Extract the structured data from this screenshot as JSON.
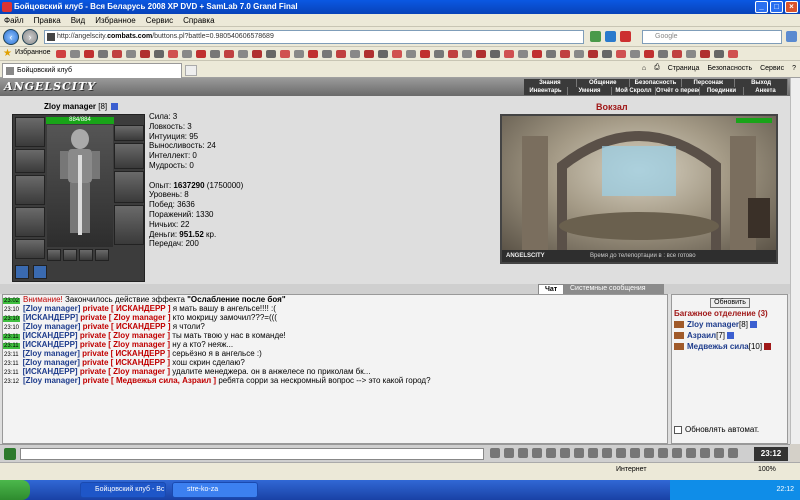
{
  "window": {
    "title": "Бойцовский клуб - Вся Беларусь 2008 XP DVD + SamLab 7.0 Grand Final"
  },
  "menu": [
    "Файл",
    "Правка",
    "Вид",
    "Избранное",
    "Сервис",
    "Справка"
  ],
  "address": {
    "url_prefix": "http://angelscity.",
    "url_domain": "combats.com",
    "url_suffix": "/buttons.pl?battle=0.980540606578689",
    "search_placeholder": "Google"
  },
  "favorites": {
    "label": "Избранное"
  },
  "tab": {
    "title": "Бойцовский клуб"
  },
  "command_bar": {
    "page": "Страница",
    "security": "Безопасность",
    "service": "Сервис"
  },
  "game": {
    "logo": "ANGELSCITY",
    "menu_top": [
      "Знания",
      "Общение",
      "Безопасность",
      "Персонаж",
      "Выход"
    ],
    "menu_bottom": [
      "Инвентарь",
      "Умения",
      "Мой Скролл",
      "Отчёт о переводах",
      "Поединки",
      "Анкета"
    ],
    "character": {
      "name": "Zloy manager",
      "level": "[8]",
      "hp": "884/884"
    },
    "stats": [
      "Сила: 3",
      "Ловкость: 3",
      "Интуиция: 95",
      "Выносливость: 24",
      "Интеллект: 0",
      "Мудрость: 0"
    ],
    "exp": {
      "label": "Опыт: ",
      "value": "1637290",
      "next": " (1750000)"
    },
    "info": [
      "Уровень: 8",
      "Побед: 3636",
      "Поражений: 1330",
      "Ничьих: 22"
    ],
    "money": {
      "label": "Деньги: ",
      "value": "951.52",
      "unit": " кр."
    },
    "transfers": "Передач: 200",
    "location": {
      "name": "Вокзал",
      "brand": "ANGELSCITY",
      "status": "Время до телепортации в : все готово"
    }
  },
  "chat": {
    "tabs": [
      "Чат",
      "Системные сообщения"
    ],
    "messages": [
      {
        "time": "23:02",
        "hl": true,
        "warn": "Внимание!",
        "text": " Закончилось действие эффекта ",
        "bold": "\"Ослабление после боя\""
      },
      {
        "time": "23:10",
        "hl": false,
        "from": "[Zloy manager]",
        "to": "private [ ИСКАНДЕРР ]",
        "text": " я мать вашу в ангельсе!!!! :("
      },
      {
        "time": "23:10",
        "hl": true,
        "from": "[ИСКАНДЕРР]",
        "to": "private [ Zloy manager ]",
        "text": " кто мокрицу замочил???=((("
      },
      {
        "time": "23:10",
        "hl": false,
        "from": "[Zloy manager]",
        "to": "private [ ИСКАНДЕРР ]",
        "text": " я чтоли?"
      },
      {
        "time": "23:11",
        "hl": true,
        "from": "[ИСКАНДЕРР]",
        "to": "private [ Zloy manager ]",
        "text": " ты мать твою у нас в команде!"
      },
      {
        "time": "23:11",
        "hl": true,
        "from": "[ИСКАНДЕРР]",
        "to": "private [ Zloy manager ]",
        "text": " ну а кто? неяж..."
      },
      {
        "time": "23:11",
        "hl": false,
        "from": "[Zloy manager]",
        "to": "private [ ИСКАНДЕРР ]",
        "text": " серьёзно я в ангельсе :)"
      },
      {
        "time": "23:11",
        "hl": false,
        "from": "[Zloy manager]",
        "to": "private [ ИСКАНДЕРР ]",
        "text": " хош скрин сделаю?"
      },
      {
        "time": "23:11",
        "hl": false,
        "from": "[ИСКАНДЕРР]",
        "to": "private [ Zloy manager ]",
        "text": " удалите менеджера. он в анжелесе по приколам бк..."
      },
      {
        "time": "23:12",
        "hl": false,
        "from": "[Zloy manager]",
        "to": "private [ Медвежья сила, Азраил ]",
        "text": " ребята сорри за нескромный вопрос --> это какой город?"
      }
    ]
  },
  "side": {
    "refresh": "Обновить",
    "title": "Багажное отделение (3)",
    "users": [
      {
        "name": "Zloy manager",
        "level": "[8]"
      },
      {
        "name": "Азраил",
        "level": "[7]"
      },
      {
        "name": "Медвежья сила",
        "level": "[10]"
      }
    ],
    "auto_refresh": "Обновлять автомат."
  },
  "game_clock": "23:12",
  "status": {
    "zone": "Интернет",
    "zoom": "100%"
  },
  "taskbar": {
    "task1": "Бойцовский клуб - Вс...",
    "task2": "stre-ko-za",
    "time": "22:12"
  }
}
